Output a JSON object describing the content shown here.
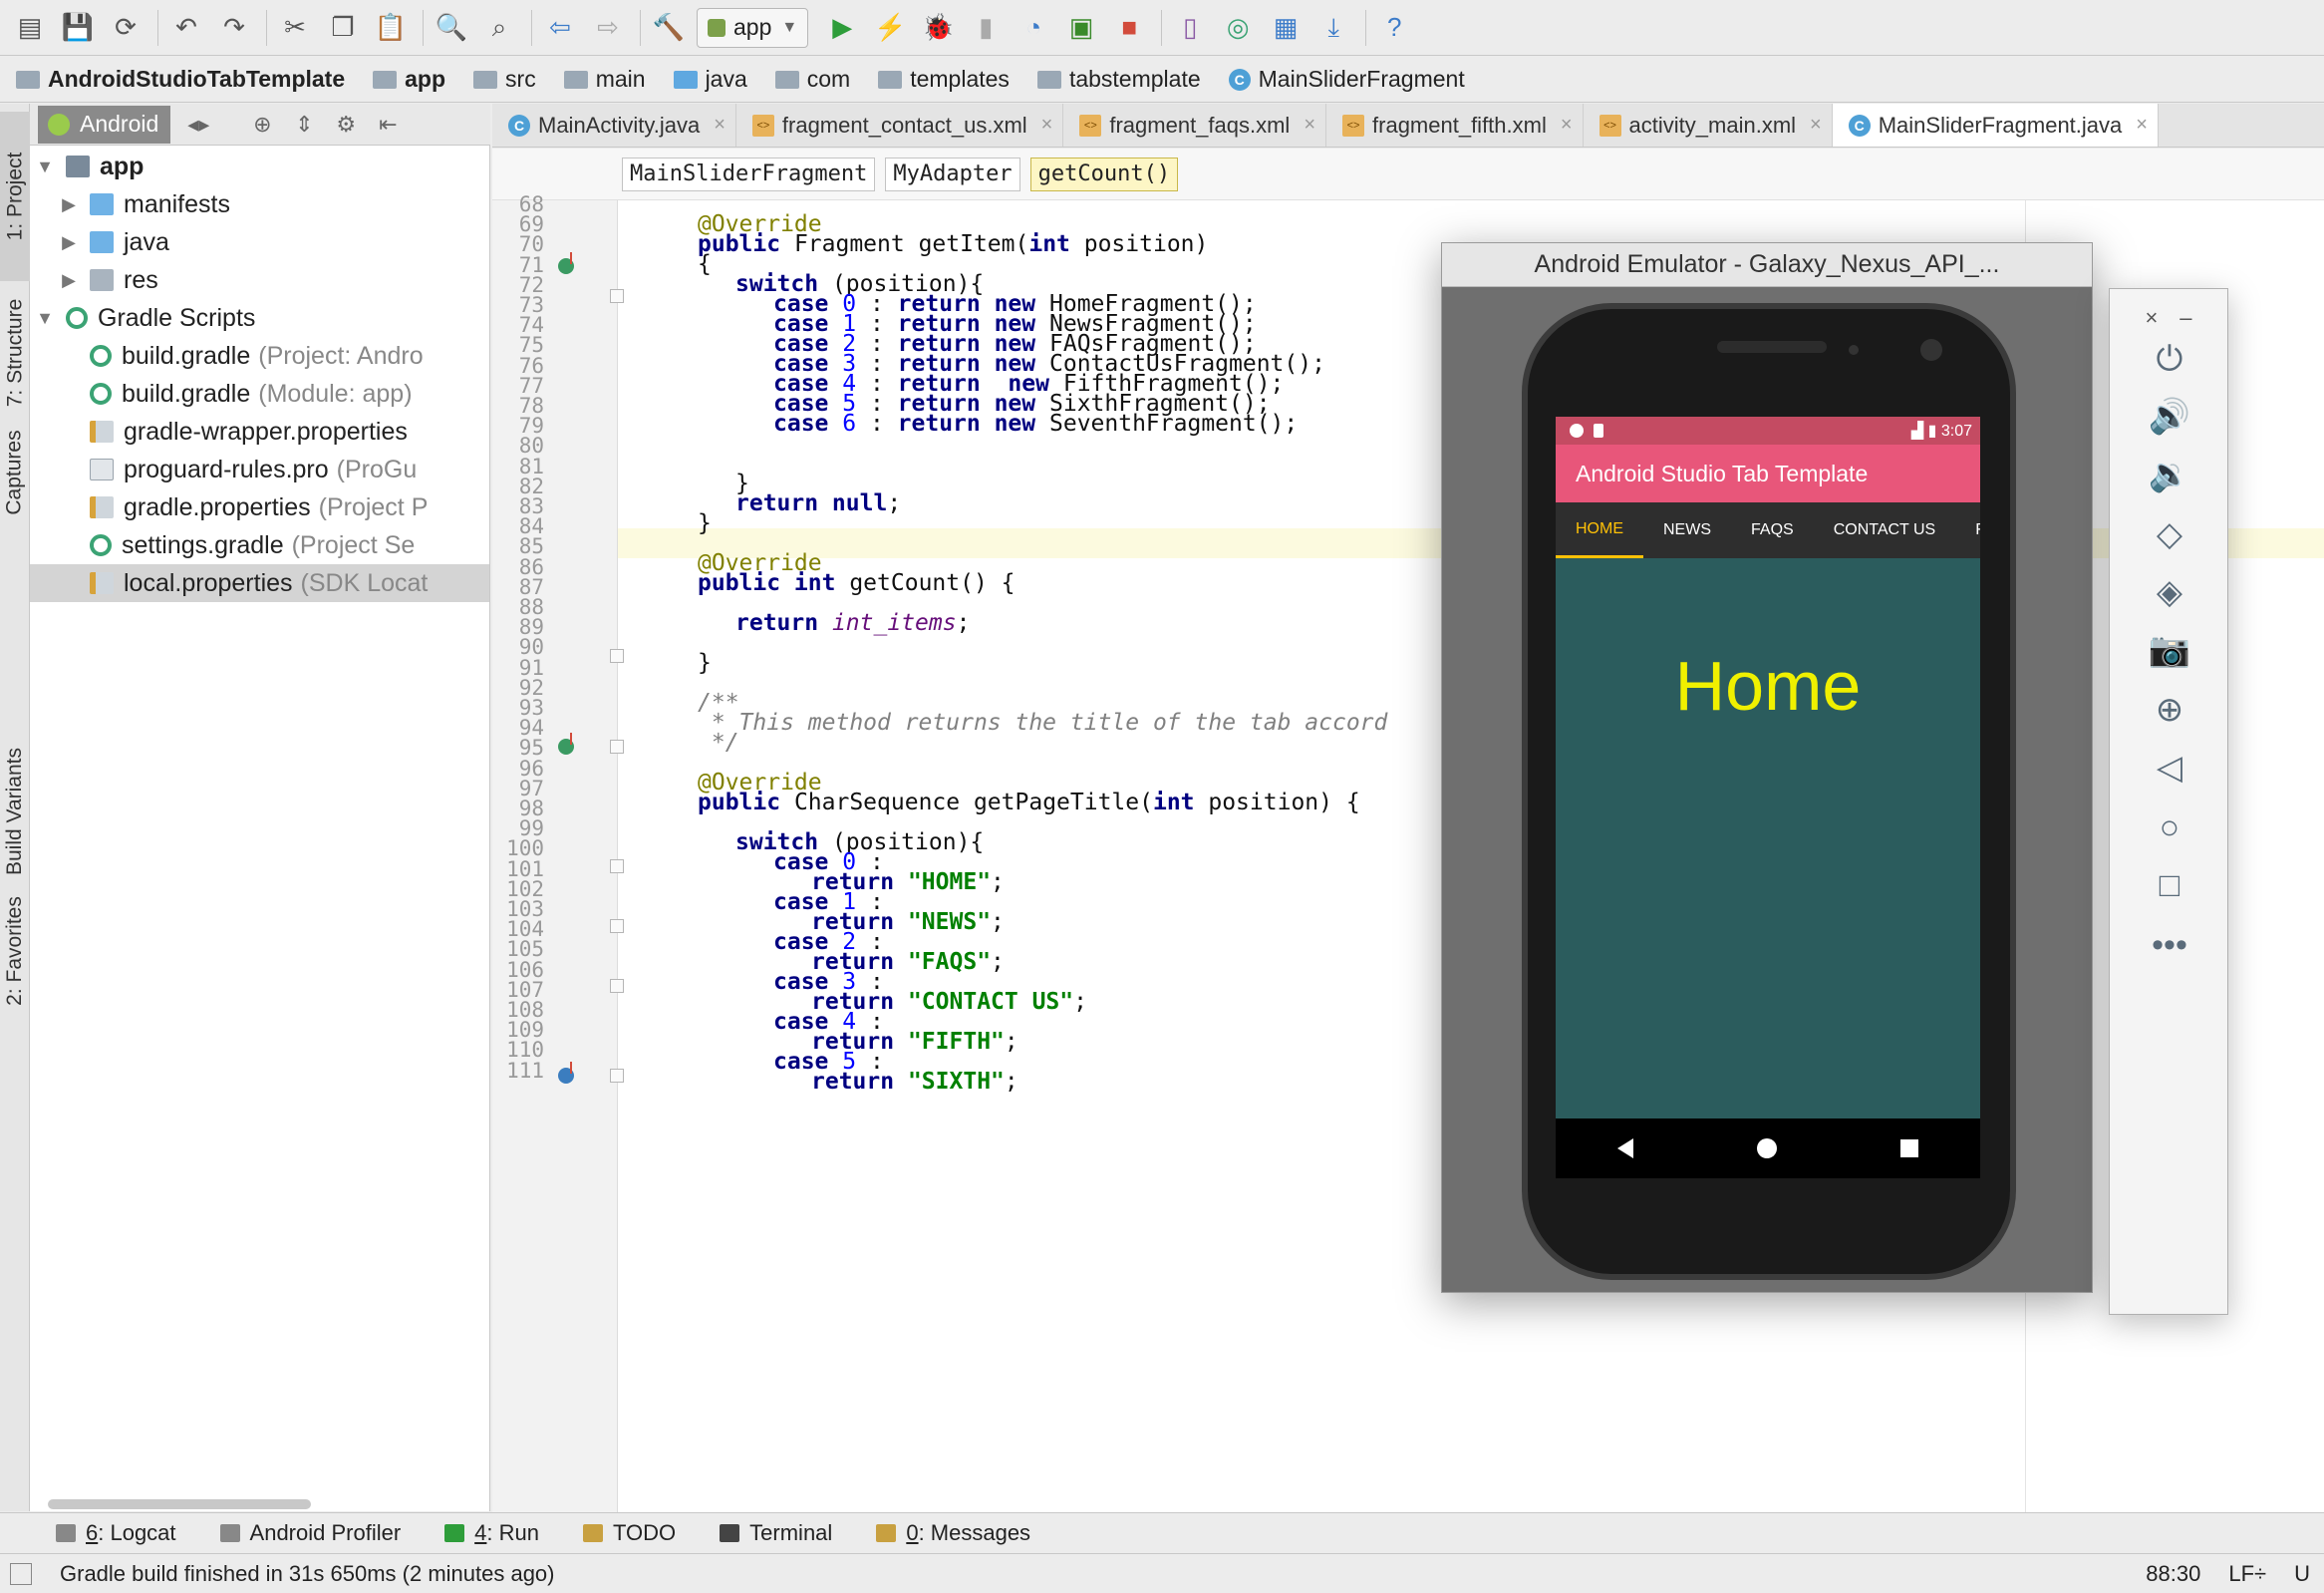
{
  "toolbar": {
    "run_config": "app",
    "icons": [
      "open-icon",
      "save-icon",
      "sync-icon",
      "undo-icon",
      "redo-icon",
      "cut-icon",
      "copy-icon",
      "paste-icon",
      "find-icon",
      "replace-icon",
      "back-icon",
      "forward-icon",
      "build-icon",
      "run-icon",
      "apply-changes-icon",
      "debug-icon",
      "profile-icon",
      "attach-debugger-icon",
      "stop-icon",
      "avd-manager-icon",
      "gradle-sync-icon",
      "project-structure-icon",
      "sdk-manager-icon",
      "help-icon"
    ]
  },
  "breadcrumb": [
    "AndroidStudioTabTemplate",
    "app",
    "src",
    "main",
    "java",
    "com",
    "templates",
    "tabstemplate",
    "MainSliderFragment"
  ],
  "left_strip": {
    "project": "1: Project",
    "structure": "7: Structure",
    "captures": "Captures",
    "build_variants": "Build Variants",
    "favorites": "2: Favorites"
  },
  "project_panel": {
    "view": "Android",
    "tree": [
      {
        "label": "app",
        "hint": ""
      },
      {
        "label": "manifests",
        "hint": ""
      },
      {
        "label": "java",
        "hint": ""
      },
      {
        "label": "res",
        "hint": ""
      },
      {
        "label": "Gradle Scripts",
        "hint": ""
      },
      {
        "label": "build.gradle",
        "hint": "(Project: Andro"
      },
      {
        "label": "build.gradle",
        "hint": "(Module: app)"
      },
      {
        "label": "gradle-wrapper.properties",
        "hint": ""
      },
      {
        "label": "proguard-rules.pro",
        "hint": "(ProGu"
      },
      {
        "label": "gradle.properties",
        "hint": "(Project P"
      },
      {
        "label": "settings.gradle",
        "hint": "(Project Se"
      },
      {
        "label": "local.properties",
        "hint": "(SDK Locat"
      }
    ]
  },
  "editor_tabs": [
    "MainActivity.java",
    "fragment_contact_us.xml",
    "fragment_faqs.xml",
    "fragment_fifth.xml",
    "activity_main.xml",
    "MainSliderFragment.java"
  ],
  "editor_crumbs": [
    "MainSliderFragment",
    "MyAdapter",
    "getCount()"
  ],
  "code": {
    "line_numbers": [
      "68",
      "69",
      "70",
      "71",
      "72",
      "73",
      "74",
      "75",
      "76",
      "77",
      "78",
      "79",
      "80",
      "81",
      "82",
      "83",
      "84",
      "85",
      "86",
      "87",
      "88",
      "89",
      "90",
      "91",
      "92",
      "93",
      "94",
      "95",
      "96",
      "97",
      "98",
      "99",
      "100",
      "101",
      "102",
      "103",
      "104",
      "105",
      "106",
      "107",
      "108",
      "109",
      "110",
      "111"
    ],
    "override": "@Override",
    "getItem_sig": "public Fragment getItem(int position)",
    "open_brace": "{",
    "close_brace": "}",
    "switch_pos": "switch (position){",
    "cases_fragment": [
      {
        "n": "0",
        "rest": "HomeFragment();"
      },
      {
        "n": "1",
        "rest": "NewsFragment();"
      },
      {
        "n": "2",
        "rest": "FAQsFragment();"
      },
      {
        "n": "3",
        "rest": "ContactUsFragment();"
      },
      {
        "n": "4",
        "rest": "FifthFragment();"
      },
      {
        "n": "5",
        "rest": "SixthFragment();"
      },
      {
        "n": "6",
        "rest": "SeventhFragment();"
      }
    ],
    "return_null": "return null;",
    "getCount_sig": "public int getCount() {",
    "return_kw": "return",
    "int_items": "int_items",
    "javadoc_open": "/**",
    "javadoc_body": " * This method returns the title of the tab accord",
    "javadoc_close": " */",
    "getPageTitle_sig": "public CharSequence getPageTitle(int position) {",
    "cases_titles": [
      {
        "n": "0",
        "title": "\"HOME\""
      },
      {
        "n": "1",
        "title": "\"NEWS\""
      },
      {
        "n": "2",
        "title": "\"FAQS\""
      },
      {
        "n": "3",
        "title": "\"CONTACT US\""
      },
      {
        "n": "4",
        "title": "\"FIFTH\""
      },
      {
        "n": "5",
        "title": "\"SIXTH\""
      }
    ]
  },
  "emulator": {
    "title": "Android Emulator - Galaxy_Nexus_API_...",
    "time": "3:07",
    "app_title": "Android Studio Tab Template",
    "tabs": [
      "HOME",
      "NEWS",
      "FAQS",
      "CONTACT US",
      "FIF"
    ],
    "selected_tab": "HOME",
    "page_text": "Home",
    "controls": [
      "power-icon",
      "volume-up-icon",
      "volume-down-icon",
      "rotate-left-icon",
      "rotate-right-icon",
      "camera-icon",
      "zoom-icon",
      "back-icon",
      "home-icon",
      "overview-icon",
      "more-icon"
    ]
  },
  "bottom_tools": [
    {
      "num": "6",
      "label": ": Logcat"
    },
    {
      "num": "",
      "label": "Android Profiler"
    },
    {
      "num": "4",
      "label": ": Run"
    },
    {
      "num": "",
      "label": "TODO"
    },
    {
      "num": "",
      "label": "Terminal"
    },
    {
      "num": "0",
      "label": ": Messages"
    }
  ],
  "status": {
    "message": "Gradle build finished in 31s 650ms (2 minutes ago)",
    "position": "88:30",
    "line_sep": "LF÷",
    "encoding": "U"
  },
  "colors": {
    "keyword": "#000080",
    "annotation": "#808000",
    "number": "#0000ff",
    "string": "#008000",
    "field": "#660e7a",
    "app_bar": "#e8567a",
    "screen_bg": "#2b5c5d",
    "tab_indicator": "#ffc107",
    "page_text": "#f0f000"
  }
}
